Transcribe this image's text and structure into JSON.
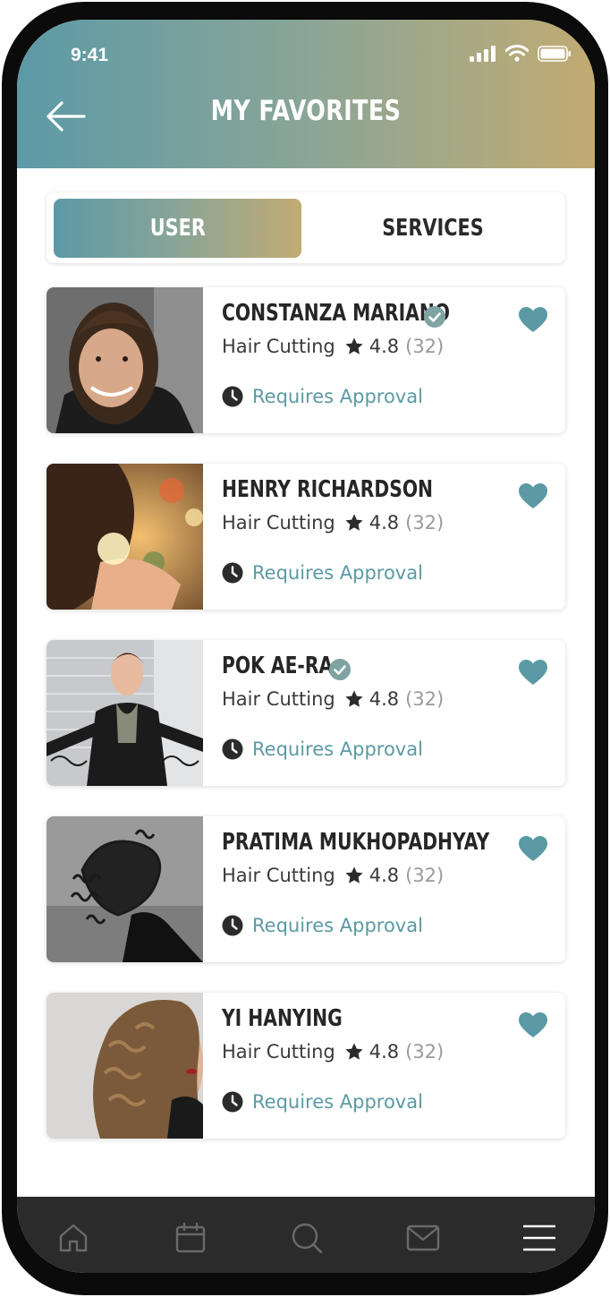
{
  "status_bar": {
    "time": "9:41"
  },
  "header": {
    "title": "MY FAVORITES"
  },
  "tabs": [
    {
      "label": "USER",
      "active": true
    },
    {
      "label": "SERVICES",
      "active": false
    }
  ],
  "favorites": [
    {
      "name": "CONSTANZA MARIANO",
      "verified": true,
      "service": "Hair Cutting",
      "rating": "4.8",
      "reviews": "(32)",
      "status": "Requires Approval"
    },
    {
      "name": "HENRY RICHARDSON",
      "verified": false,
      "service": "Hair Cutting",
      "rating": "4.8",
      "reviews": "(32)",
      "status": "Requires Approval"
    },
    {
      "name": "POK AE-RA",
      "verified": true,
      "service": "Hair Cutting",
      "rating": "4.8",
      "reviews": "(32)",
      "status": "Requires Approval"
    },
    {
      "name": "PRATIMA MUKHOPADHYAY",
      "verified": false,
      "service": "Hair Cutting",
      "rating": "4.8",
      "reviews": "(32)",
      "status": "Requires Approval"
    },
    {
      "name": "YI HANYING",
      "verified": false,
      "service": "Hair Cutting",
      "rating": "4.8",
      "reviews": "(32)",
      "status": "Requires Approval"
    }
  ],
  "tab_bar": [
    {
      "icon": "home-icon"
    },
    {
      "icon": "calendar-icon"
    },
    {
      "icon": "search-icon"
    },
    {
      "icon": "mail-icon"
    },
    {
      "icon": "menu-icon",
      "active": true
    }
  ],
  "colors": {
    "gradient_start": "#5c9aa6",
    "gradient_end": "#c2ab72",
    "accent": "#5b9aa4",
    "tab_bar": "#2b2b2b"
  }
}
